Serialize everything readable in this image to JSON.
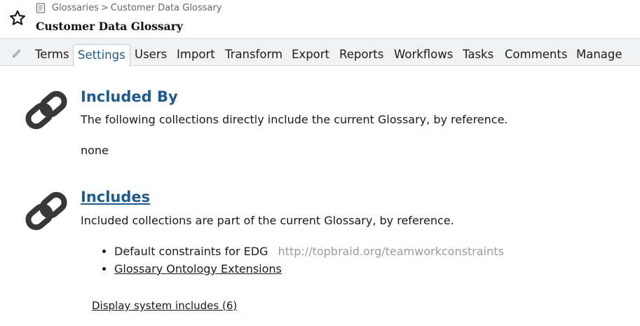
{
  "header": {
    "breadcrumb": {
      "root": "Glossaries",
      "separator": ">",
      "current": "Customer Data Glossary"
    },
    "title": "Customer Data Glossary",
    "favorite_icon": "star-icon",
    "breadcrumb_icon": "book-icon"
  },
  "tabs": [
    {
      "label": "Terms"
    },
    {
      "label": "Settings",
      "active": true
    },
    {
      "label": "Users"
    },
    {
      "label": "Import"
    },
    {
      "label": "Transform"
    },
    {
      "label": "Export"
    },
    {
      "label": "Reports"
    },
    {
      "label": "Workflows"
    },
    {
      "label": "Tasks"
    },
    {
      "label": "Comments"
    },
    {
      "label": "Manage"
    }
  ],
  "edit_icon": "pencil-icon",
  "included_by": {
    "icon": "link-icon",
    "title": "Included By",
    "description": "The following collections directly include the current Glossary, by reference.",
    "empty_text": "none"
  },
  "includes": {
    "icon": "link-icon",
    "title": "Includes",
    "description": "Included collections are part of the current Glossary, by reference.",
    "items": [
      {
        "label": "Default constraints for EDG",
        "uri": "http://topbraid.org/teamworkconstraints"
      },
      {
        "label": "Glossary Ontology Extensions"
      }
    ],
    "system_link": "Display system includes (6)"
  },
  "colors": {
    "accent": "#1e5b8c",
    "tabbar_bg": "#f1f2f3",
    "icon": "#333333",
    "muted": "#9b9b9b"
  }
}
